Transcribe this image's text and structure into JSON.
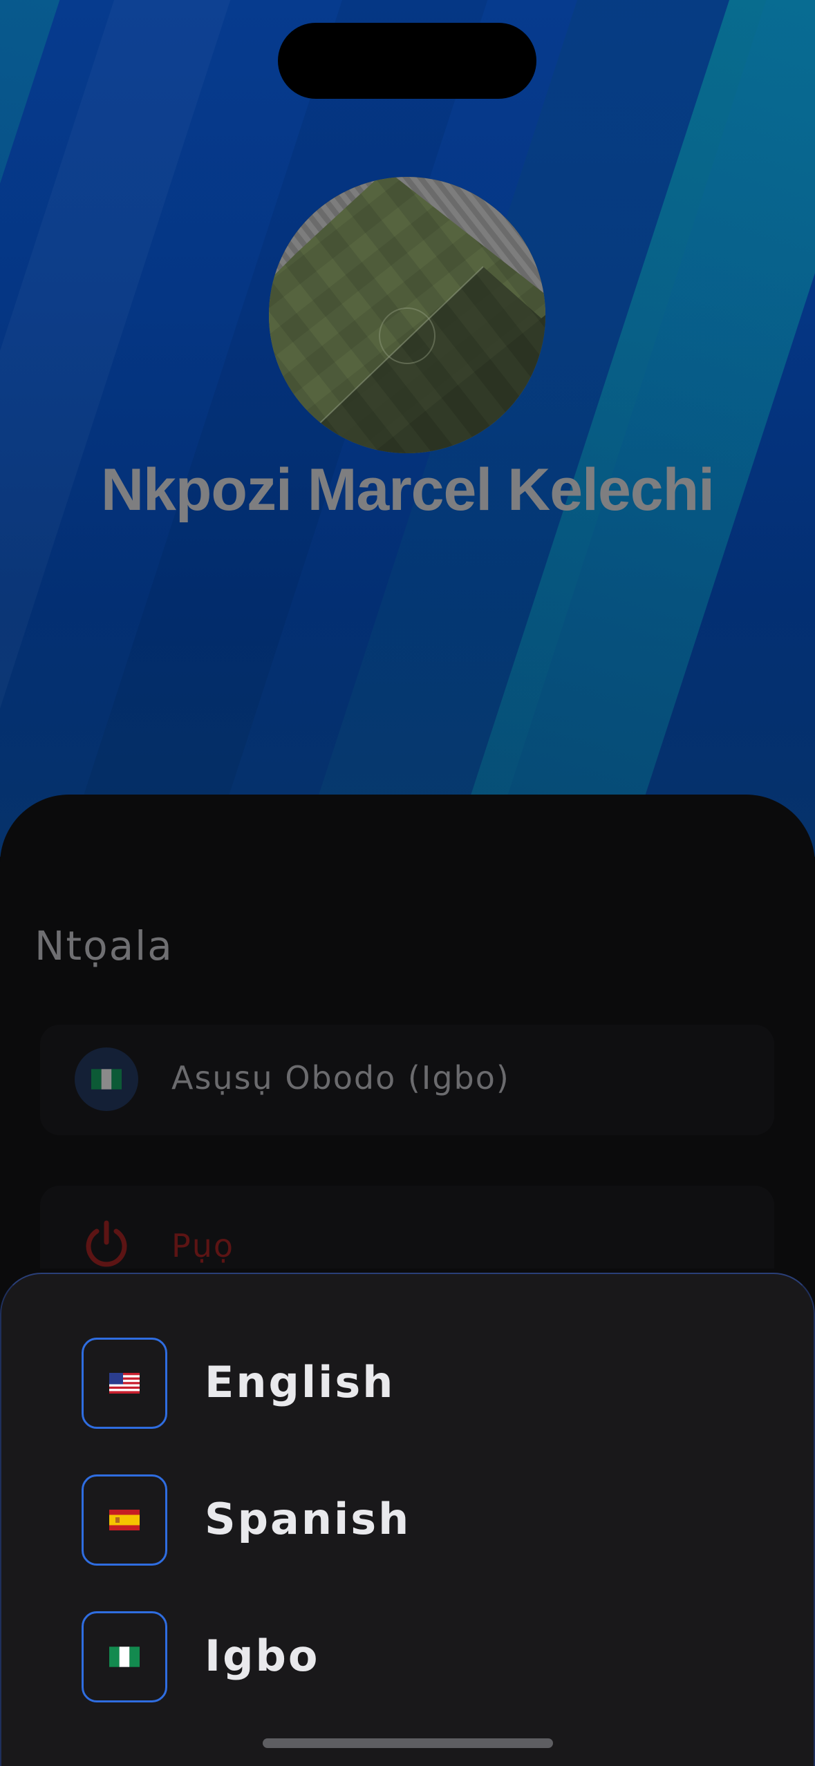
{
  "profile": {
    "name": "Nkpozi Marcel Kelechi"
  },
  "settings": {
    "section_title": "Ntọala",
    "language_row_label": "Asụsụ Obodo (Igbo)",
    "logout_label": "Pụọ"
  },
  "language_picker": {
    "options": [
      {
        "label": "English",
        "flag": "us-flag-icon"
      },
      {
        "label": "Spanish",
        "flag": "spain-flag-icon"
      },
      {
        "label": "Igbo",
        "flag": "nigeria-flag-icon"
      }
    ]
  },
  "colors": {
    "accent": "#2f6de0",
    "header_blue": "#053684",
    "sheet_bg": "#19181a",
    "logout_red": "#5c1414"
  }
}
